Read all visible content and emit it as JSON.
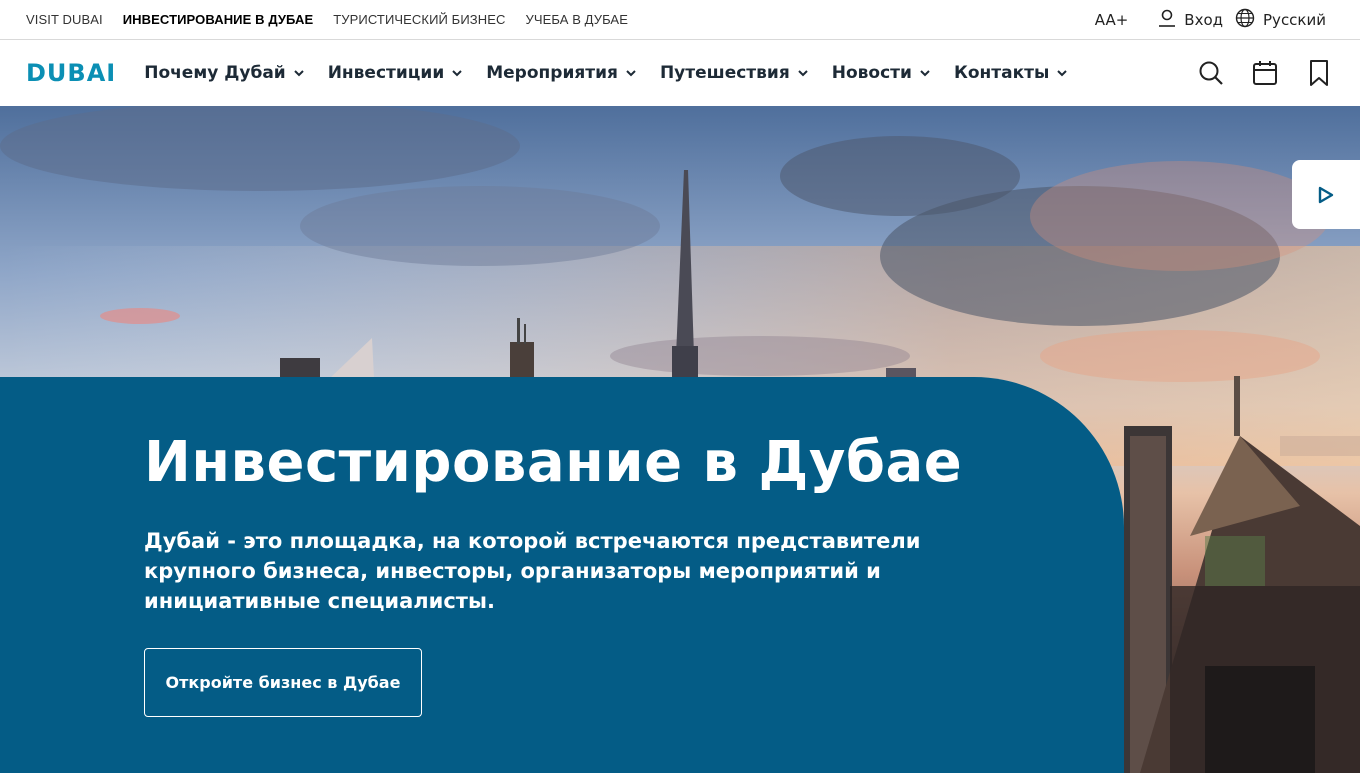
{
  "topbar": {
    "links": [
      {
        "label": "VISIT DUBAI"
      },
      {
        "label": "ИНВЕСТИРОВАНИЕ В ДУБАЕ"
      },
      {
        "label": "ТУРИСТИЧЕСКИЙ БИЗНЕС"
      },
      {
        "label": "УЧЕБА В ДУБАЕ"
      }
    ],
    "font_size_label": "AA+",
    "login_label": "Вход",
    "language_label": "Русский"
  },
  "nav": {
    "logo_text": "DUBAI",
    "menu": [
      {
        "label": "Почему Дубай"
      },
      {
        "label": "Инвестиции"
      },
      {
        "label": "Мероприятия"
      },
      {
        "label": "Путешествия"
      },
      {
        "label": "Новости"
      },
      {
        "label": "Контакты"
      }
    ]
  },
  "hero": {
    "title": "Инвестирование в Дубае",
    "subtitle": "Дубай - это площадка, на которой встречаются представители крупного бизнеса, инвесторы, организаторы мероприятий и инициативные специалисты.",
    "cta_label": "Откройте бизнес в Дубае"
  },
  "colors": {
    "panel": "#045c86",
    "logo": "#0b8fb4",
    "nav_text": "#1d2a36"
  },
  "icons": {
    "user": "user-icon",
    "globe": "globe-icon",
    "search": "search-icon",
    "calendar": "calendar-icon",
    "bookmark": "bookmark-icon",
    "play": "play-icon",
    "chevron": "chevron-down-icon"
  }
}
